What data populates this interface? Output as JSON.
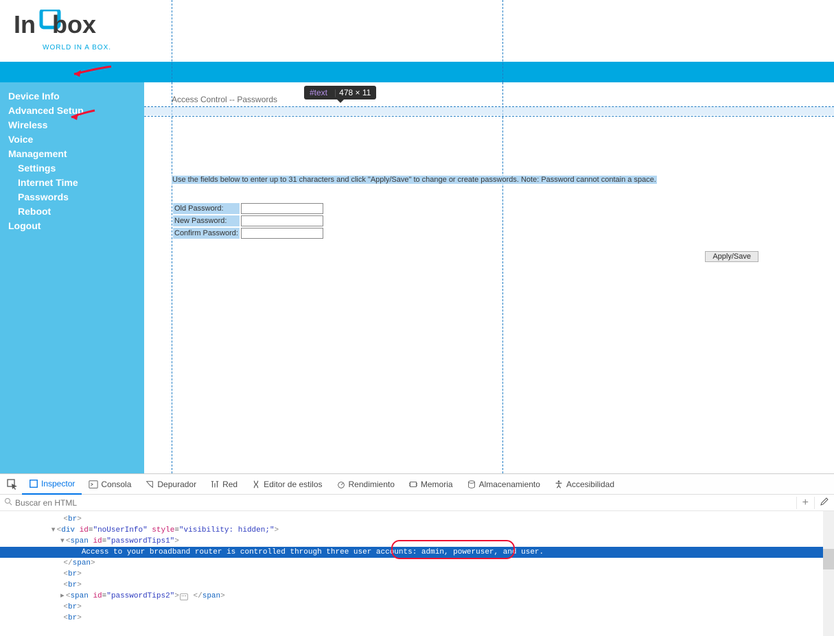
{
  "brand": {
    "tagline": "WORLD IN A BOX."
  },
  "nav": {
    "device_info": "Device Info",
    "advanced_setup": "Advanced Setup",
    "wireless": "Wireless",
    "voice": "Voice",
    "management": "Management",
    "settings": "Settings",
    "internet_time": "Internet Time",
    "passwords": "Passwords",
    "reboot": "Reboot",
    "logout": "Logout"
  },
  "tooltip": {
    "tag": "#text",
    "dim": "478 × 11"
  },
  "page": {
    "title": "Access Control -- Passwords",
    "help": "Use the fields below to enter up to 31 characters and click \"Apply/Save\" to change or create passwords. Note: Password cannot contain a space.",
    "old_label": "Old Password:",
    "new_label": "New Password:",
    "confirm_label": "Confirm Password:",
    "apply_btn": "Apply/Save"
  },
  "devtools": {
    "tabs": {
      "inspector": "Inspector",
      "consola": "Consola",
      "depurador": "Depurador",
      "red": "Red",
      "editor": "Editor de estilos",
      "rendimiento": "Rendimiento",
      "memoria": "Memoria",
      "almacenamiento": "Almacenamiento",
      "accesibilidad": "Accesibilidad"
    },
    "search_placeholder": "Buscar en HTML",
    "code": {
      "br": "br",
      "div": "div",
      "span": "span",
      "id": "id",
      "style": "style",
      "noUserInfo_id": "\"noUserInfo\"",
      "noUserInfo_style": "\"visibility: hidden;\"",
      "tips1_id": "\"passwordTips1\"",
      "tips2_id": "\"passwordTips2\"",
      "text_line": "Access to your broadband router is controlled through three user accounts: admin, poweruser, and user."
    }
  }
}
